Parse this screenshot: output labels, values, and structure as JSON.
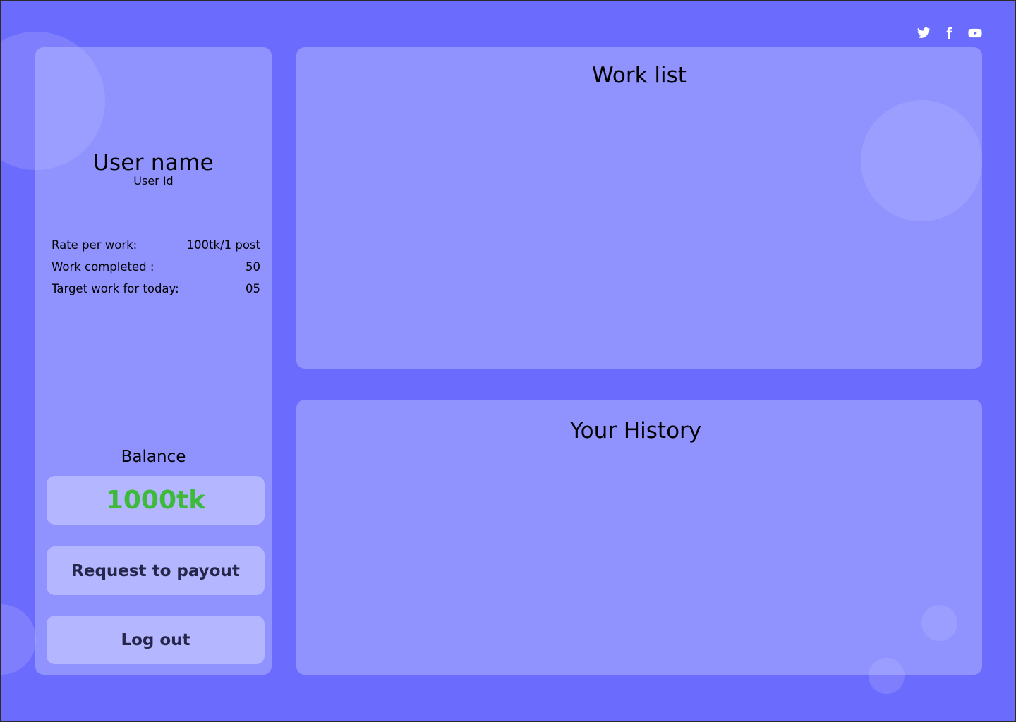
{
  "social": {
    "twitter": "twitter-icon",
    "facebook": "facebook-icon",
    "youtube": "youtube-icon"
  },
  "profile": {
    "name": "User name",
    "id": "User Id",
    "stats": [
      {
        "label": "Rate per work:",
        "value": "100tk/1 post"
      },
      {
        "label": "Work completed :",
        "value": "50"
      },
      {
        "label": "Target work for today:",
        "value": "05"
      }
    ],
    "balance_label": "Balance",
    "balance_value": "1000tk",
    "payout_label": "Request to payout",
    "logout_label": "Log out"
  },
  "work_list": {
    "title": "Work list"
  },
  "history": {
    "title": "Your History"
  },
  "colors": {
    "background": "#6b6bfe",
    "balance_text": "#3fb93a"
  }
}
